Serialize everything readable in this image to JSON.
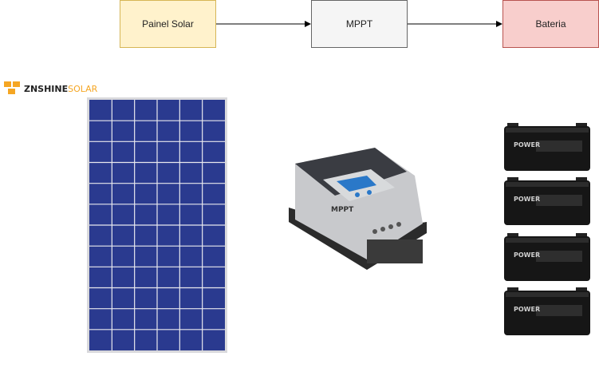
{
  "blocks": [
    {
      "label": "Painel Solar",
      "fill": "#FFF2CC",
      "stroke": "#D6B656"
    },
    {
      "label": "MPPT",
      "fill": "#F5F5F5",
      "stroke": "#666666"
    },
    {
      "label": "Bateria",
      "fill": "#F8CECC",
      "stroke": "#B85450"
    }
  ],
  "logo": {
    "part1": "ZNSHINE",
    "part2": "SOLAR",
    "color1": "#222222",
    "color2": "#F5A623"
  },
  "controller": {
    "brand_text": "MPPT"
  },
  "battery": {
    "brand_text": "POWER",
    "count": 4
  }
}
